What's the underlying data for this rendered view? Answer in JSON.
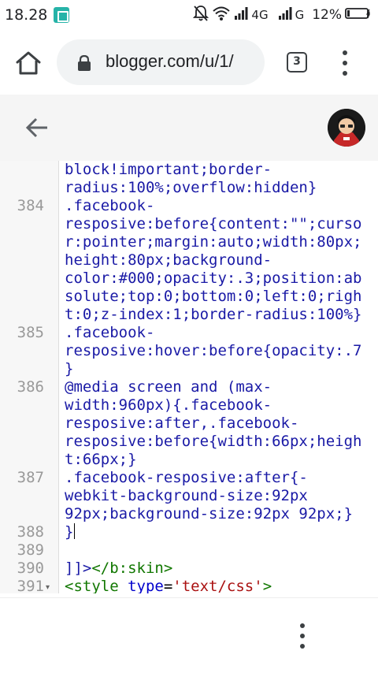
{
  "status_bar": {
    "time": "18.28",
    "net_1": "4G",
    "net_2": "G",
    "battery": "12%",
    "icons": [
      "screenshot-icon",
      "mute-icon",
      "wifi-icon",
      "signal-icon",
      "battery-icon"
    ]
  },
  "browser": {
    "url": "blogger.com/u/1/",
    "tab_count": "3",
    "icons": [
      "home-icon",
      "lock-icon",
      "tabs-icon",
      "more-vert-icon"
    ]
  },
  "blogger_header": {
    "icons": [
      "back-arrow-icon",
      "avatar"
    ]
  },
  "editor": {
    "lines": [
      {
        "num": "",
        "text": "block!important;border-",
        "kind": "plain"
      },
      {
        "num": "",
        "text": "radius:100%;overflow:hidden}",
        "kind": "plain"
      },
      {
        "num": "384",
        "text": ".facebook-",
        "kind": "plain"
      },
      {
        "num": "",
        "text": "resposive:before{content:\"\";curso",
        "kind": "plain"
      },
      {
        "num": "",
        "text": "r:pointer;margin:auto;width:80px;",
        "kind": "plain"
      },
      {
        "num": "",
        "text": "height:80px;background-",
        "kind": "plain"
      },
      {
        "num": "",
        "text": "color:#000;opacity:.3;position:ab",
        "kind": "plain"
      },
      {
        "num": "",
        "text": "solute;top:0;bottom:0;left:0;righ",
        "kind": "plain"
      },
      {
        "num": "",
        "text": "t:0;z-index:1;border-radius:100%}",
        "kind": "plain"
      },
      {
        "num": "385",
        "text": ".facebook-",
        "kind": "plain"
      },
      {
        "num": "",
        "text": "resposive:hover:before{opacity:.7",
        "kind": "plain"
      },
      {
        "num": "",
        "text": "}",
        "kind": "plain"
      },
      {
        "num": "386",
        "text": "@media screen and (max-",
        "kind": "plain"
      },
      {
        "num": "",
        "text": "width:960px){.facebook-",
        "kind": "plain"
      },
      {
        "num": "",
        "text": "resposive:after,.facebook-",
        "kind": "plain"
      },
      {
        "num": "",
        "text": "resposive:before{width:66px;heigh",
        "kind": "plain"
      },
      {
        "num": "",
        "text": "t:66px;}",
        "kind": "plain"
      },
      {
        "num": "387",
        "text": ".facebook-resposive:after{-",
        "kind": "plain"
      },
      {
        "num": "",
        "text": "webkit-background-size:92px",
        "kind": "plain"
      },
      {
        "num": "",
        "text": "92px;background-size:92px 92px;}",
        "kind": "plain"
      },
      {
        "num": "388",
        "text": "}",
        "kind": "caret"
      },
      {
        "num": "389",
        "text": "",
        "kind": "plain"
      },
      {
        "num": "390",
        "text": "]]></b:skin>",
        "kind": "skin"
      },
      {
        "num": "391",
        "text": "<style type='text/css'>",
        "kind": "style",
        "fold": "▾"
      }
    ],
    "style_tag_parts": {
      "open": "<style ",
      "attr": "type",
      "eq": "=",
      "val": "'text/css'",
      "close": ">"
    },
    "skin_parts": {
      "cdata": "]]>",
      "tag": "</b:skin>"
    }
  },
  "colors": {
    "code": "#1a1aa6",
    "tag": "#117700",
    "attr": "#0000cc",
    "string": "#aa1111",
    "gutter_text": "#999999",
    "accent_teal": "#26b3a8"
  }
}
